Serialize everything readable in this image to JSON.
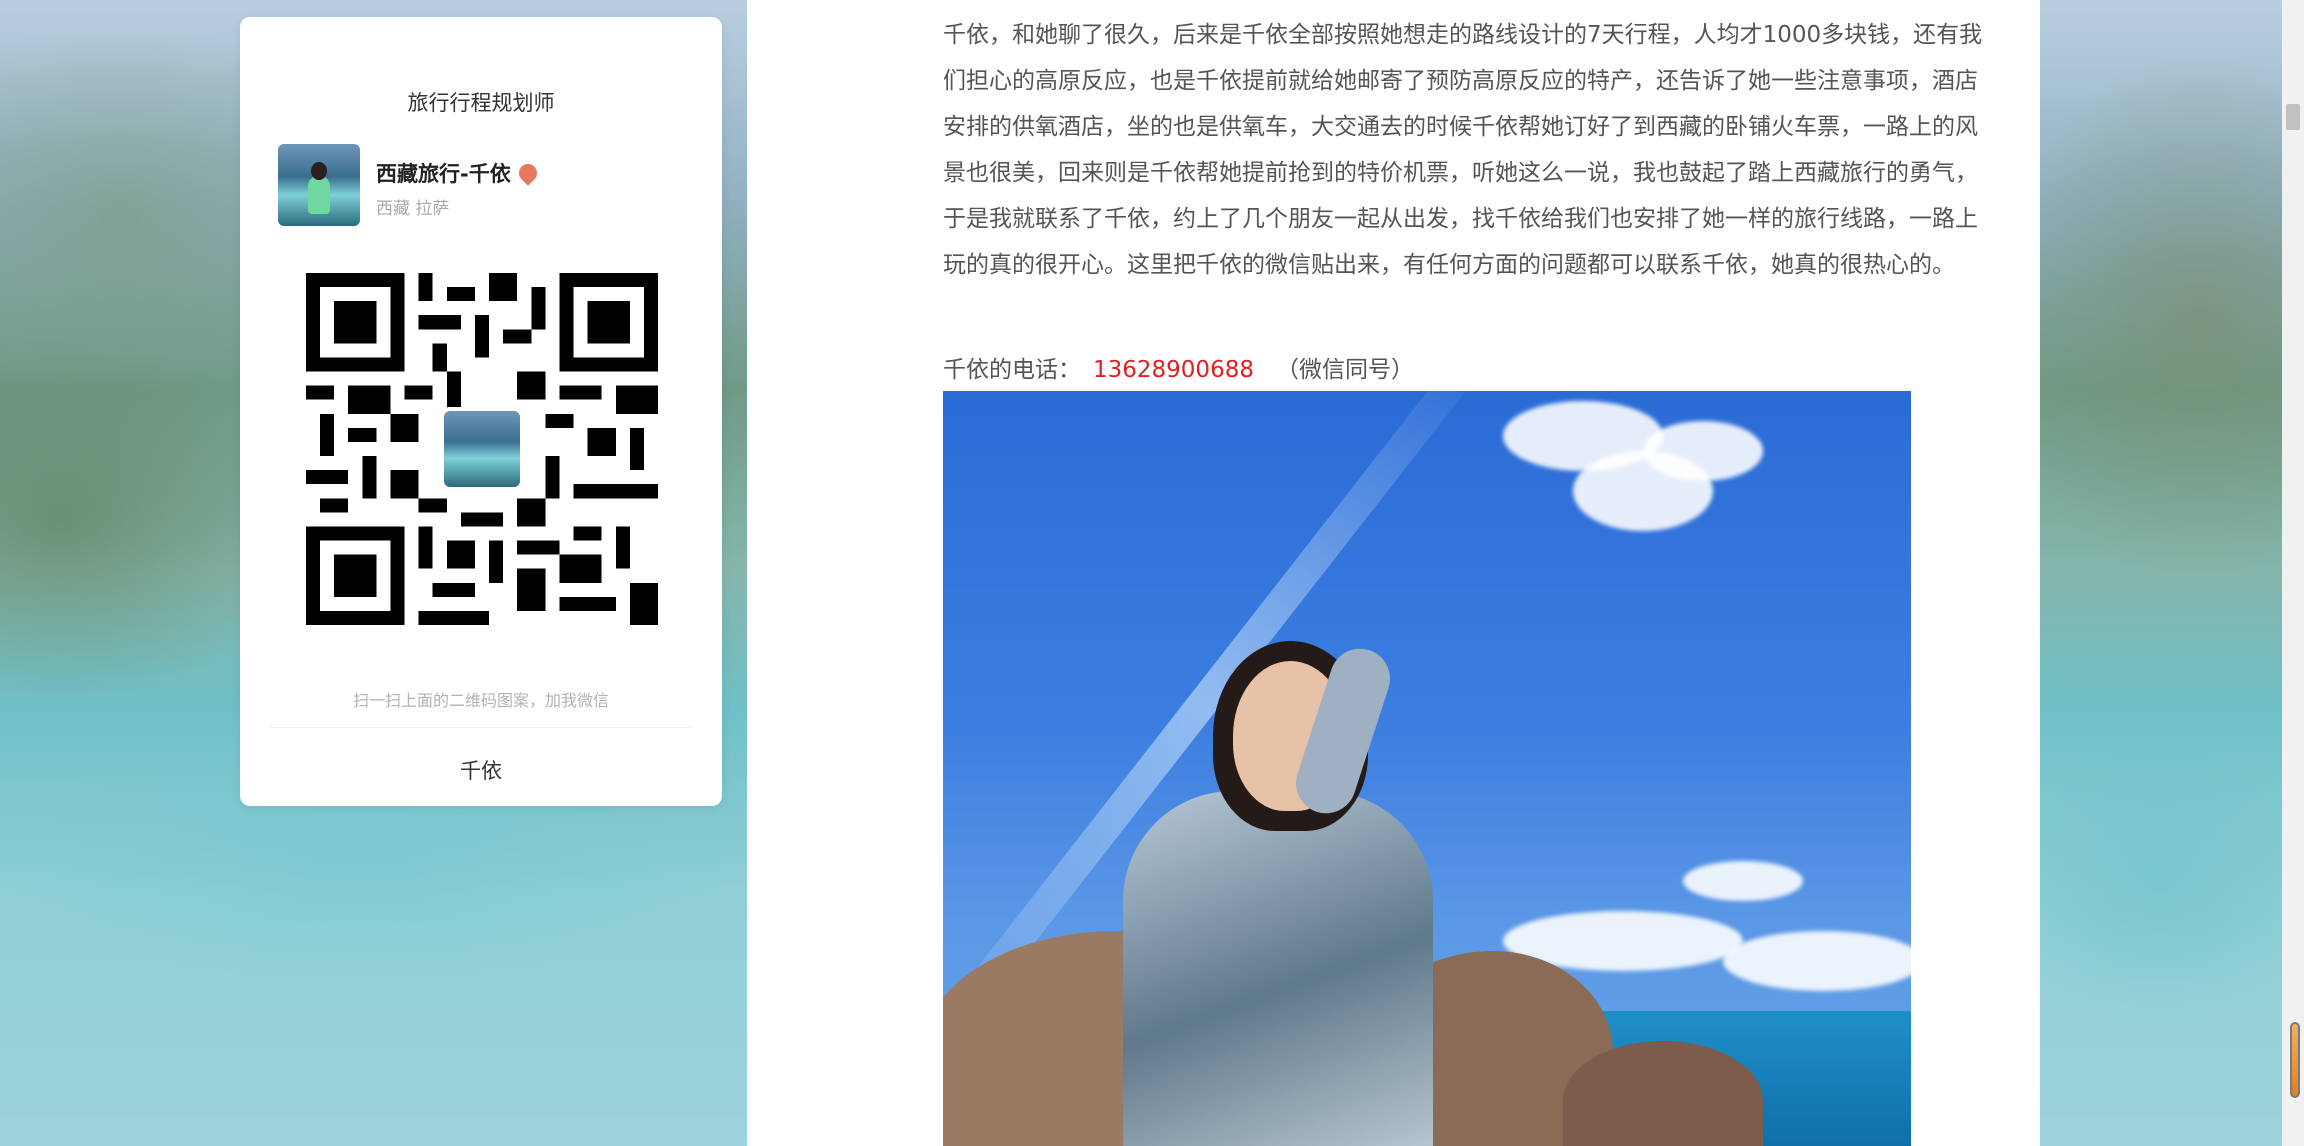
{
  "card": {
    "title": "旅行行程规划师",
    "profile_name": "西藏旅行-千依",
    "profile_location": "西藏 拉萨",
    "qr_hint": "扫一扫上面的二维码图案，加我微信",
    "footer_name": "千依"
  },
  "article": {
    "paragraph": "千依，和她聊了很久，后来是千依全部按照她想走的路线设计的7天行程，人均才1000多块钱，还有我们担心的高原反应，也是千依提前就给她邮寄了预防高原反应的特产，还告诉了她一些注意事项，酒店安排的供氧酒店，坐的也是供氧车，大交通去的时候千依帮她订好了到西藏的卧铺火车票，一路上的风景也很美，回来则是千依帮她提前抢到的特价机票，听她这么一说，我也鼓起了踏上西藏旅行的勇气，于是我就联系了千依，约上了几个朋友一起从出发，找千依给我们也安排了她一样的旅行线路，一路上玩的真的很开心。这里把千依的微信贴出来，有任何方面的问题都可以联系千依，她真的很热心的。",
    "phone_label": "千依的电话：",
    "phone_number": "13628900688",
    "phone_note": "（微信同号）"
  },
  "colors": {
    "phone_number": "#e02020",
    "text": "#555555"
  }
}
